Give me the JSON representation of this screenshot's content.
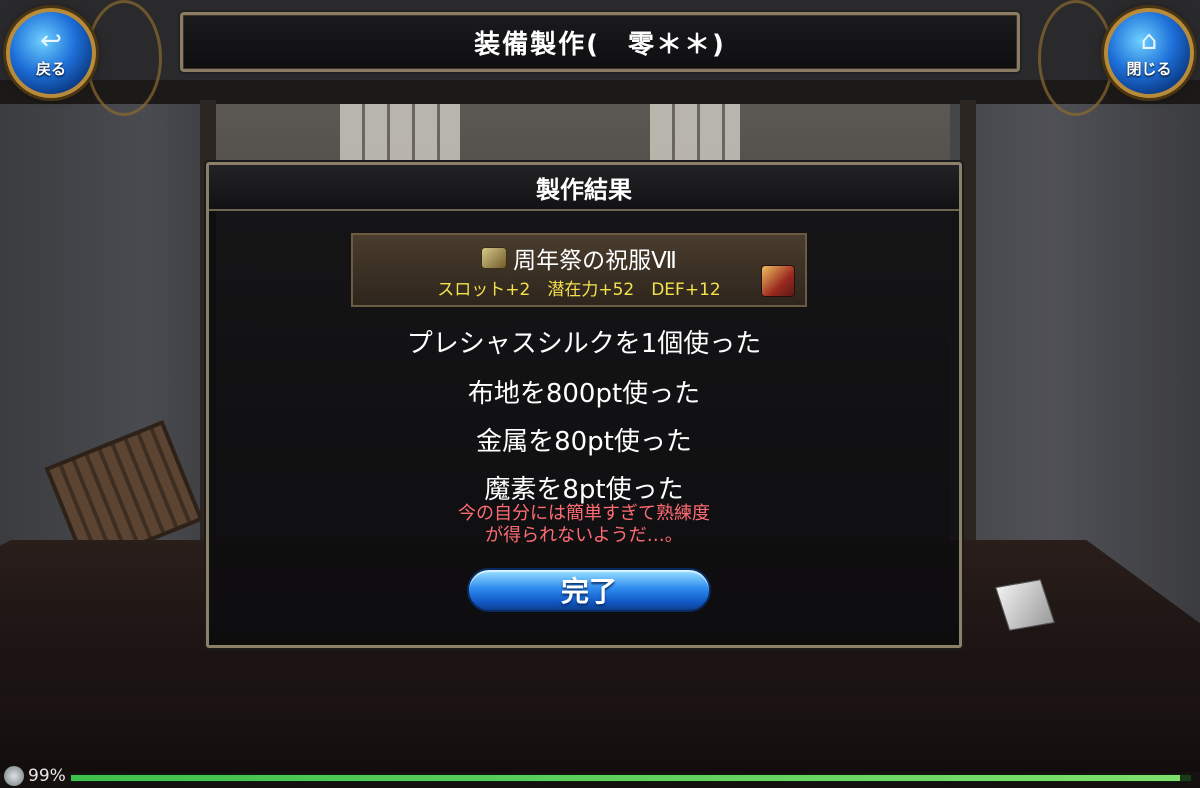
{
  "header": {
    "title": "装備製作(　零＊＊)",
    "back_label": "戻る",
    "back_icon": "return-arrow-icon",
    "close_label": "閉じる",
    "close_icon": "home-icon"
  },
  "result": {
    "heading": "製作結果",
    "item": {
      "name": "周年祭の祝服Ⅶ",
      "stats": "スロット+2　潜在力+52　DEF+12",
      "icon": "cloth-item-icon",
      "right_icon": "treasure-chest-icon"
    },
    "usage": [
      "プレシャスシルクを1個使った",
      "布地を800pt使った",
      "金属を80pt使った",
      "魔素を8pt使った"
    ],
    "warning_line1": "今の自分には簡単すぎて熟練度",
    "warning_line2": "が得られないようだ…。",
    "done_label": "完了"
  },
  "status": {
    "percent_text": "99%",
    "progress": 0.99
  },
  "colors": {
    "stats_yellow": "#f3e24d",
    "warning_red": "#ff6b73",
    "button_blue": "#2f8df0",
    "frame_gold": "#8d8069"
  }
}
